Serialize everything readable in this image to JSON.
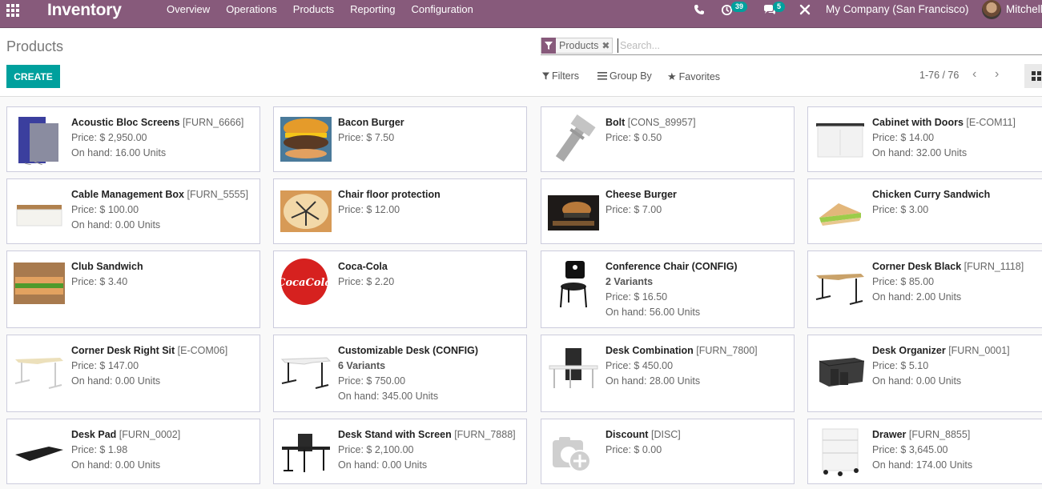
{
  "navbar": {
    "brand": "Inventory",
    "menu": [
      "Overview",
      "Operations",
      "Products",
      "Reporting",
      "Configuration"
    ],
    "activity_count": "39",
    "message_count": "5",
    "company": "My Company (San Francisco)",
    "user": "Mitchell",
    "icons": [
      "apps-grid-icon",
      "phone-icon",
      "activity-clock-icon",
      "chat-icon",
      "tools-icon"
    ]
  },
  "control": {
    "title": "Products",
    "create_label": "CREATE",
    "facet_label": "Products",
    "search_placeholder": "Search...",
    "filters_label": "Filters",
    "groupby_label": "Group By",
    "favorites_label": "Favorites",
    "pager": "1-76 / 76"
  },
  "products": [
    {
      "name": "Acoustic Bloc Screens",
      "ref": "[FURN_6666]",
      "price": "Price: $ 2,950.00",
      "onhand": "On hand: 16.00 Units",
      "variants": ""
    },
    {
      "name": "Bacon Burger",
      "ref": "",
      "price": "Price: $ 7.50",
      "onhand": "",
      "variants": ""
    },
    {
      "name": "Bolt",
      "ref": "[CONS_89957]",
      "price": "Price: $ 0.50",
      "onhand": "",
      "variants": ""
    },
    {
      "name": "Cabinet with Doors",
      "ref": "[E-COM11]",
      "price": "Price: $ 14.00",
      "onhand": "On hand: 32.00 Units",
      "variants": ""
    },
    {
      "name": "Cable Management Box",
      "ref": "[FURN_5555]",
      "price": "Price: $ 100.00",
      "onhand": "On hand: 0.00 Units",
      "variants": ""
    },
    {
      "name": "Chair floor protection",
      "ref": "",
      "price": "Price: $ 12.00",
      "onhand": "",
      "variants": ""
    },
    {
      "name": "Cheese Burger",
      "ref": "",
      "price": "Price: $ 7.00",
      "onhand": "",
      "variants": ""
    },
    {
      "name": "Chicken Curry Sandwich",
      "ref": "",
      "price": "Price: $ 3.00",
      "onhand": "",
      "variants": ""
    },
    {
      "name": "Club Sandwich",
      "ref": "",
      "price": "Price: $ 3.40",
      "onhand": "",
      "variants": ""
    },
    {
      "name": "Coca-Cola",
      "ref": "",
      "price": "Price: $ 2.20",
      "onhand": "",
      "variants": ""
    },
    {
      "name": "Conference Chair (CONFIG)",
      "ref": "",
      "price": "Price: $ 16.50",
      "onhand": "On hand: 56.00 Units",
      "variants": "2 Variants"
    },
    {
      "name": "Corner Desk Black",
      "ref": "[FURN_1118]",
      "price": "Price: $ 85.00",
      "onhand": "On hand: 2.00 Units",
      "variants": ""
    },
    {
      "name": "Corner Desk Right Sit",
      "ref": "[E-COM06]",
      "price": "Price: $ 147.00",
      "onhand": "On hand: 0.00 Units",
      "variants": ""
    },
    {
      "name": "Customizable Desk (CONFIG)",
      "ref": "",
      "price": "Price: $ 750.00",
      "onhand": "On hand: 345.00 Units",
      "variants": "6 Variants"
    },
    {
      "name": "Desk Combination",
      "ref": "[FURN_7800]",
      "price": "Price: $ 450.00",
      "onhand": "On hand: 28.00 Units",
      "variants": ""
    },
    {
      "name": "Desk Organizer",
      "ref": "[FURN_0001]",
      "price": "Price: $ 5.10",
      "onhand": "On hand: 0.00 Units",
      "variants": ""
    },
    {
      "name": "Desk Pad",
      "ref": "[FURN_0002]",
      "price": "Price: $ 1.98",
      "onhand": "On hand: 0.00 Units",
      "variants": ""
    },
    {
      "name": "Desk Stand with Screen",
      "ref": "[FURN_7888]",
      "price": "Price: $ 2,100.00",
      "onhand": "On hand: 0.00 Units",
      "variants": ""
    },
    {
      "name": "Discount",
      "ref": "[DISC]",
      "price": "Price: $ 0.00",
      "onhand": "",
      "variants": ""
    },
    {
      "name": "Drawer",
      "ref": "[FURN_8855]",
      "price": "Price: $ 3,645.00",
      "onhand": "On hand: 174.00 Units",
      "variants": ""
    }
  ],
  "colors": {
    "brand": "#875a7b",
    "accent": "#00a09d"
  }
}
